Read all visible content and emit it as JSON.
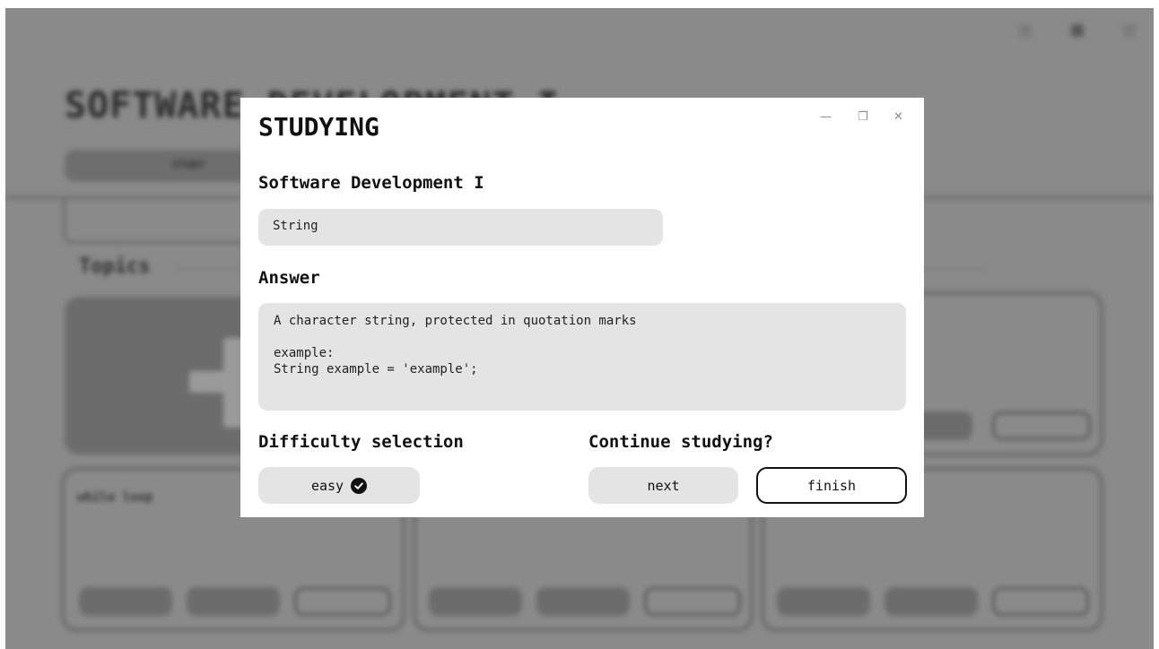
{
  "background": {
    "page_title": "SOFTWARE DEVELOPMENT I",
    "study_pill_label": "STUDY",
    "topics_heading": "Topics",
    "cards": [
      {
        "title": "while loop"
      },
      {
        "title": ""
      },
      {
        "title": ""
      }
    ]
  },
  "modal": {
    "title": "STUDYING",
    "window_controls": {
      "minimize": "—",
      "restore": "❐",
      "close": "✕"
    },
    "deck_heading": "Software Development I",
    "question": "String",
    "answer_heading": "Answer",
    "answer_lines": [
      "A character string, protected in quotation marks",
      "",
      "example:",
      "String example = 'example';"
    ],
    "difficulty_heading": "Difficulty selection",
    "difficulty_value": "easy",
    "continue_heading": "Continue studying?",
    "next_label": "next",
    "finish_label": "finish"
  }
}
